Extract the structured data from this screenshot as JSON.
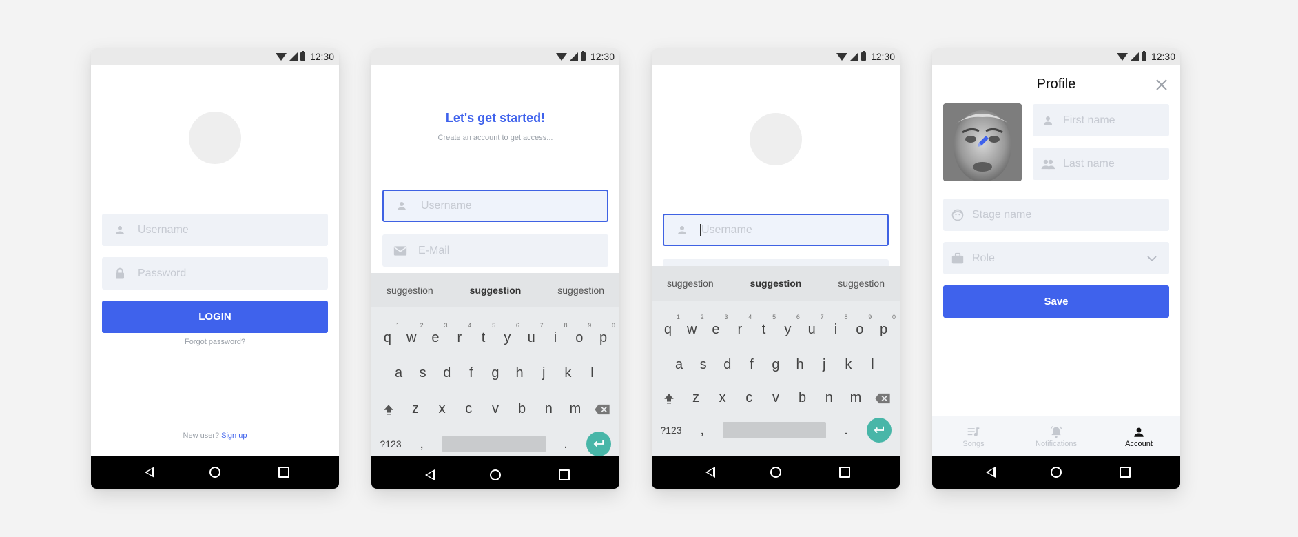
{
  "status_time": "12:30",
  "screen1": {
    "username_placeholder": "Username",
    "password_placeholder": "Password",
    "login_label": "LOGIN",
    "forgot_label": "Forgot password?",
    "new_user_text": "New user?",
    "signup_label": "Sign up"
  },
  "screen2": {
    "title": "Let's get started!",
    "subtitle": "Create an account to get access...",
    "username_placeholder": "Username",
    "email_placeholder": "E-Mail"
  },
  "screen3": {
    "username_placeholder": "Username"
  },
  "keyboard": {
    "suggestions": [
      "suggestion",
      "suggestion",
      "suggestion"
    ],
    "row1": [
      "q",
      "w",
      "e",
      "r",
      "t",
      "y",
      "u",
      "i",
      "o",
      "p"
    ],
    "row1_digits": [
      "1",
      "2",
      "3",
      "4",
      "5",
      "6",
      "7",
      "8",
      "9",
      "0"
    ],
    "row2": [
      "a",
      "s",
      "d",
      "f",
      "g",
      "h",
      "j",
      "k",
      "l"
    ],
    "row3": [
      "z",
      "x",
      "c",
      "v",
      "b",
      "n",
      "m"
    ],
    "symbols_label": "?123",
    "comma": ",",
    "period": "."
  },
  "profile": {
    "title": "Profile",
    "first_name_placeholder": "First name",
    "last_name_placeholder": "Last name",
    "stage_name_placeholder": "Stage name",
    "role_placeholder": "Role",
    "save_label": "Save",
    "tabs": [
      {
        "label": "Songs",
        "icon": "songs-icon",
        "active": false
      },
      {
        "label": "Notifications",
        "icon": "bell-icon",
        "active": false
      },
      {
        "label": "Account",
        "icon": "account-icon",
        "active": true
      }
    ]
  },
  "colors": {
    "accent": "#3f62ec",
    "field_bg": "#eff2f7",
    "enter_key": "#48b6a8",
    "background": "#f3f3f3"
  }
}
